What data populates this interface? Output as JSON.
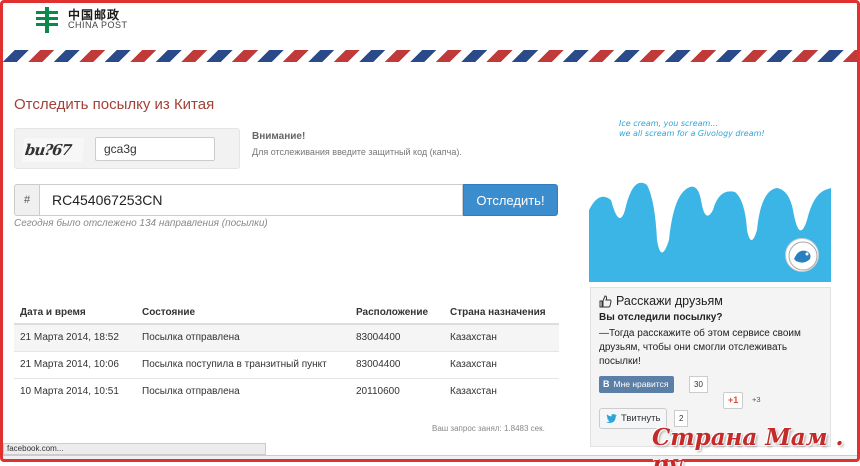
{
  "logo": {
    "cn": "中国邮政",
    "en": "CHINA POST"
  },
  "page_title": "Отследить посылку из Китая",
  "captcha": {
    "code_image_text": "bu?67",
    "input_value": "gca3g"
  },
  "notice": {
    "title": "Внимание!",
    "text": "Для отслеживания введите защитный код (капча)."
  },
  "tracking": {
    "addon": "#",
    "value": "RC454067253CN",
    "button": "Отследить!"
  },
  "stats": "Сегодня было отслежено 134 направления (посылки)",
  "table": {
    "headers": [
      "Дата и время",
      "Состояние",
      "Расположение",
      "Страна назначения"
    ],
    "rows": [
      [
        "21 Марта 2014, 18:52",
        "Посылка отправлена",
        "83004400",
        "Казахстан"
      ],
      [
        "21 Марта 2014, 10:06",
        "Посылка поступила в транзитный пункт",
        "83004400",
        "Казахстан"
      ],
      [
        "10 Марта 2014, 10:51",
        "Посылка отправлена",
        "20110600",
        "Казахстан"
      ]
    ]
  },
  "query_time": "Ваш запрос занял: 1.8483 сек.",
  "ad": {
    "line1": "Ice cream, you scream...",
    "line2": "we all scream for a Givology dream!"
  },
  "share": {
    "title": "Расскажи друзьям",
    "question": "Вы отследили посылку?",
    "body": "—Тогда расскажите об этом сервисе своим друзьям, чтобы они смогли отслеживать посылки!",
    "vk_label": "Мне нравится",
    "vk_count": "30",
    "gplus_label": "+1",
    "gplus_count": "+3",
    "twitter_label": "Твитнуть",
    "twitter_count": "2"
  },
  "statusbar": "facebook.com...",
  "watermark": "Страна Мам . ру",
  "colors": {
    "accent": "#a34138",
    "button": "#3c8dce",
    "frame": "#e03030",
    "ad_blue": "#3ab5e6"
  }
}
